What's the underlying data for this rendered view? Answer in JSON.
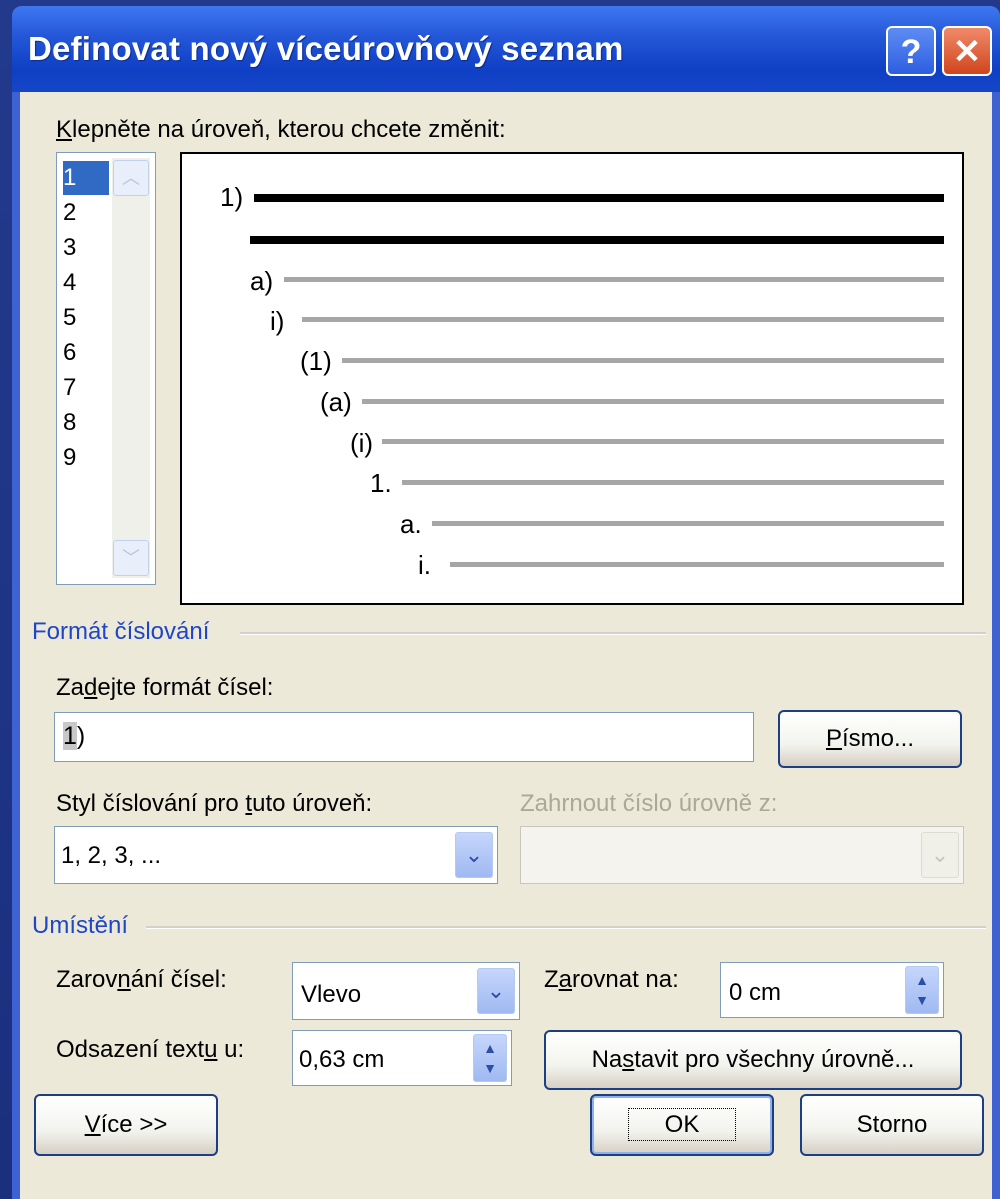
{
  "window": {
    "title": "Definovat nový víceúrovňový seznam",
    "help_label": "?",
    "close_label": "✕"
  },
  "levels": {
    "label_prefix": "K",
    "label_rest": "lepněte na úroveň, kterou chcete změnit:",
    "items": [
      "1",
      "2",
      "3",
      "4",
      "5",
      "6",
      "7",
      "8",
      "9"
    ],
    "selected": "1"
  },
  "preview": {
    "labels": [
      "1)",
      "a)",
      "i)",
      "(1)",
      "(a)",
      "(i)",
      "1.",
      "a.",
      "i."
    ]
  },
  "format_section": {
    "title": "Formát číslování",
    "format_label_a": "Za",
    "format_label_u": "d",
    "format_label_b": "ejte formát čísel:",
    "format_value_hl": "1",
    "format_value_rest": ")",
    "font_button_u": "P",
    "font_button_rest": "ísmo...",
    "style_label_a": "Styl číslování pro ",
    "style_label_u": "t",
    "style_label_b": "uto úroveň:",
    "style_value": "1, 2, 3, ...",
    "include_label": "Zahrnout číslo úrovně z:"
  },
  "position_section": {
    "title": "Umístění",
    "align_label_a": "Zarov",
    "align_label_u": "n",
    "align_label_b": "ání čísel:",
    "align_value": "Vlevo",
    "align_at_label_a": "Z",
    "align_at_label_u": "a",
    "align_at_label_b": "rovnat na:",
    "align_at_value": "0 cm",
    "indent_label_a": "Odsazení text",
    "indent_label_u": "u",
    "indent_label_b": " u:",
    "indent_value": "0,63 cm",
    "set_all_a": "Na",
    "set_all_u": "s",
    "set_all_b": "tavit pro všechny úrovně..."
  },
  "footer": {
    "more_u": "V",
    "more_rest": "íce >>",
    "ok_label": "OK",
    "cancel_label": "Storno"
  },
  "colors": {
    "section_title": "#1f46c8",
    "selection": "#316ac5",
    "titlebar": "#0f3fc4"
  }
}
